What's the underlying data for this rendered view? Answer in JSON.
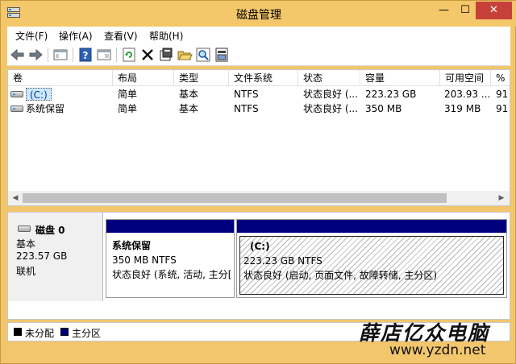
{
  "window": {
    "title": "磁盘管理",
    "min_symbol": "—",
    "max_symbol": "☐",
    "close_symbol": "✕"
  },
  "menu": [
    "文件(F)",
    "操作(A)",
    "查看(V)",
    "帮助(H)"
  ],
  "toolbar_icons": [
    "back-icon",
    "forward-icon",
    "console-tree-icon",
    "help-icon",
    "properties-pane-icon",
    "refresh-icon",
    "delete-icon",
    "properties-icon",
    "open-icon",
    "search-icon",
    "export-icon"
  ],
  "volume_table": {
    "columns": [
      "卷",
      "布局",
      "类型",
      "文件系统",
      "状态",
      "容量",
      "可用空间",
      "%"
    ],
    "rows": [
      [
        "(C:)",
        "简单",
        "基本",
        "NTFS",
        "状态良好 (...",
        "223.23 GB",
        "203.93 ...",
        "91"
      ],
      [
        "系统保留",
        "简单",
        "基本",
        "NTFS",
        "状态良好 (...",
        "350 MB",
        "319 MB",
        "91"
      ]
    ]
  },
  "disk": {
    "name": "磁盘 0",
    "type": "基本",
    "size": "223.57 GB",
    "status": "联机"
  },
  "partitions": [
    {
      "name": "系统保留",
      "size": "350 MB NTFS",
      "status": "状态良好 (系统, 活动, 主分["
    },
    {
      "name": "(C:)",
      "size": "223.23 GB NTFS",
      "status": "状态良好 (启动, 页面文件, 故障转储, 主分区)"
    }
  ],
  "legend": [
    {
      "label": "未分配",
      "color": "#000000"
    },
    {
      "label": "主分区",
      "color": "#00007f"
    }
  ],
  "watermark": {
    "line1": "薛店亿众电脑",
    "line2": "www.yzdn.net"
  }
}
